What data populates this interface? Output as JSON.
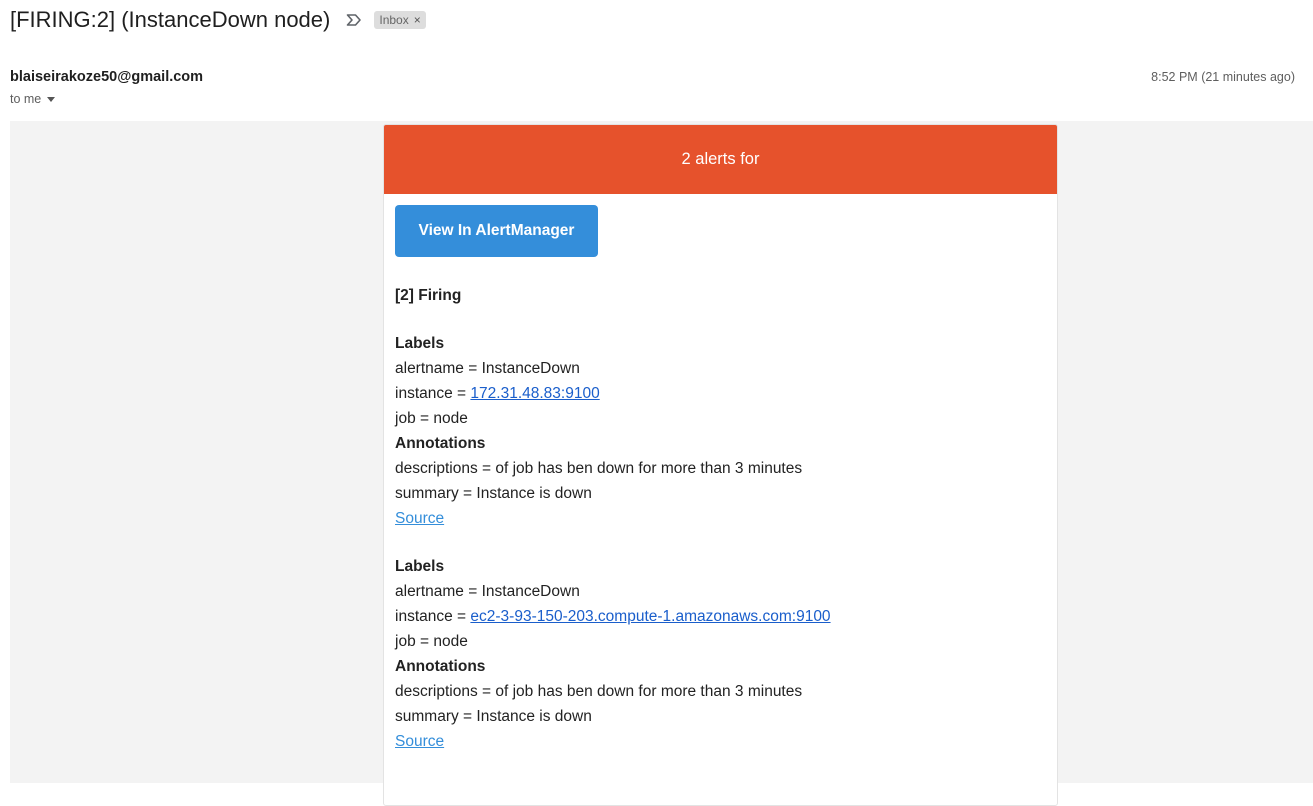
{
  "email": {
    "subject": "[FIRING:2] (InstanceDown node)",
    "label_chip": "Inbox",
    "label_chip_close": "×",
    "sender": "blaiseirakoze50@gmail.com",
    "recipient": "to me",
    "timestamp": "8:52 PM (21 minutes ago)"
  },
  "alert_card": {
    "header": "2 alerts for",
    "button_label": "View In AlertManager",
    "firing_title": "[2] Firing",
    "alerts": [
      {
        "labels_heading": "Labels",
        "alertname_text": "alertname = InstanceDown",
        "instance_prefix": "instance = ",
        "instance_link": "172.31.48.83:9100",
        "job_text": "job = node",
        "annotations_heading": "Annotations",
        "descriptions_text": "descriptions = of job has ben down for more than 3 minutes",
        "summary_text": "summary = Instance is down",
        "source_link": "Source"
      },
      {
        "labels_heading": "Labels",
        "alertname_text": "alertname = InstanceDown",
        "instance_prefix": "instance = ",
        "instance_link": "ec2-3-93-150-203.compute-1.amazonaws.com:9100",
        "job_text": "job = node",
        "annotations_heading": "Annotations",
        "descriptions_text": "descriptions = of job has ben down for more than 3 minutes",
        "summary_text": "summary = Instance is down",
        "source_link": "Source"
      }
    ]
  },
  "colors": {
    "header_bg": "#e6522c",
    "button_bg": "#348eda",
    "link": "#1a5ecb"
  },
  "icons": {
    "important_marker": "label-important-icon",
    "recipient_caret": "caret-down-icon"
  }
}
